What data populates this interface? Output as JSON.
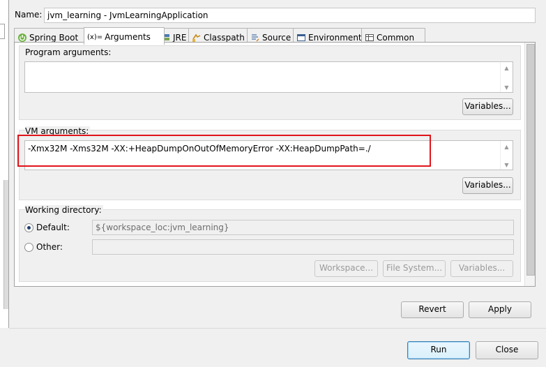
{
  "name_label": "Name:",
  "name_value": "jvm_learning - JvmLearningApplication",
  "tabs": [
    {
      "label": "Spring Boot",
      "icon": "spring-boot-icon"
    },
    {
      "label": "Arguments",
      "icon": "arguments-icon",
      "prefix": "(x)="
    },
    {
      "label": "JRE",
      "icon": "jre-icon"
    },
    {
      "label": "Classpath",
      "icon": "classpath-icon"
    },
    {
      "label": "Source",
      "icon": "source-icon"
    },
    {
      "label": "Environment",
      "icon": "environment-icon"
    },
    {
      "label": "Common",
      "icon": "common-icon"
    }
  ],
  "program_args": {
    "label": "Program arguments:",
    "value": "",
    "variables_label": "Variables..."
  },
  "vm_args": {
    "label": "VM arguments:",
    "value": "-Xmx32M -Xms32M -XX:+HeapDumpOnOutOfMemoryError -XX:HeapDumpPath=./",
    "variables_label": "Variables..."
  },
  "working_dir": {
    "label": "Working directory:",
    "default_label": "Default:",
    "default_value": "${workspace_loc:jvm_learning}",
    "other_label": "Other:",
    "other_value": "",
    "workspace_button": "Workspace...",
    "filesystem_button": "File System...",
    "variables_button": "Variables..."
  },
  "revert_label": "Revert",
  "apply_label": "Apply",
  "run_label": "Run",
  "close_label": "Close",
  "colors": {
    "highlight_box": "#e0141b",
    "default_button": "#3c7fb1"
  }
}
